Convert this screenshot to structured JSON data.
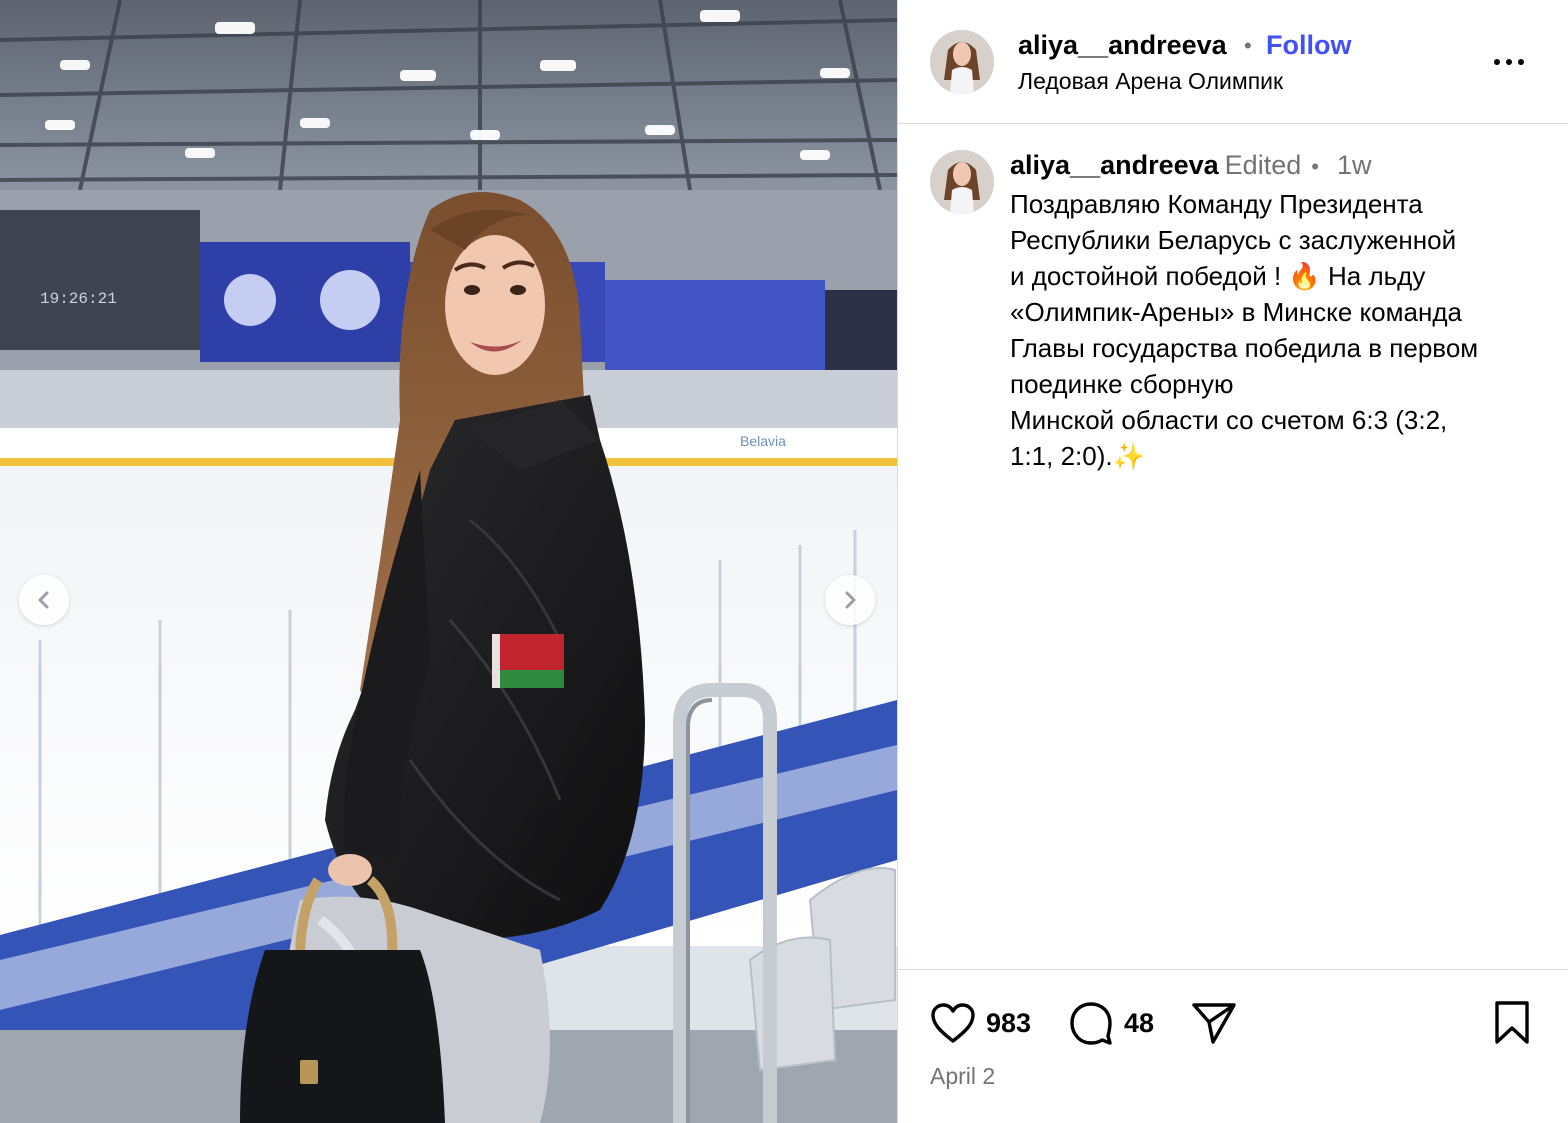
{
  "post": {
    "username": "aliya__andreeva",
    "follow_label": "Follow",
    "location": "Ледовая Арена Олимпик",
    "more_icon": "more-options-icon"
  },
  "caption": {
    "username": "aliya__andreeva",
    "edited_label": "Edited",
    "separator": "•",
    "time_ago": "1w",
    "lines": [
      "Поздравляю Команду Президента",
      "Республики Беларусь с заслуженной",
      "и достойной победой ! 🔥 На льду",
      "«Олимпик-Арены» в Минске команда",
      "Главы государства победила в первом",
      "поединке сборную",
      "Минской области со счетом 6:3 (3:2,",
      "1:1, 2:0).✨"
    ]
  },
  "actions": {
    "likes": "983",
    "comments": "48",
    "date": "April 2",
    "icons": [
      "heart-icon",
      "comment-icon",
      "share-icon",
      "bookmark-icon"
    ]
  },
  "media": {
    "scoreboard_time": "19:26:21",
    "arena_banner": "Belavia"
  },
  "colors": {
    "accent": "#4150f7",
    "muted": "#737373",
    "border": "#dbdbdb"
  }
}
